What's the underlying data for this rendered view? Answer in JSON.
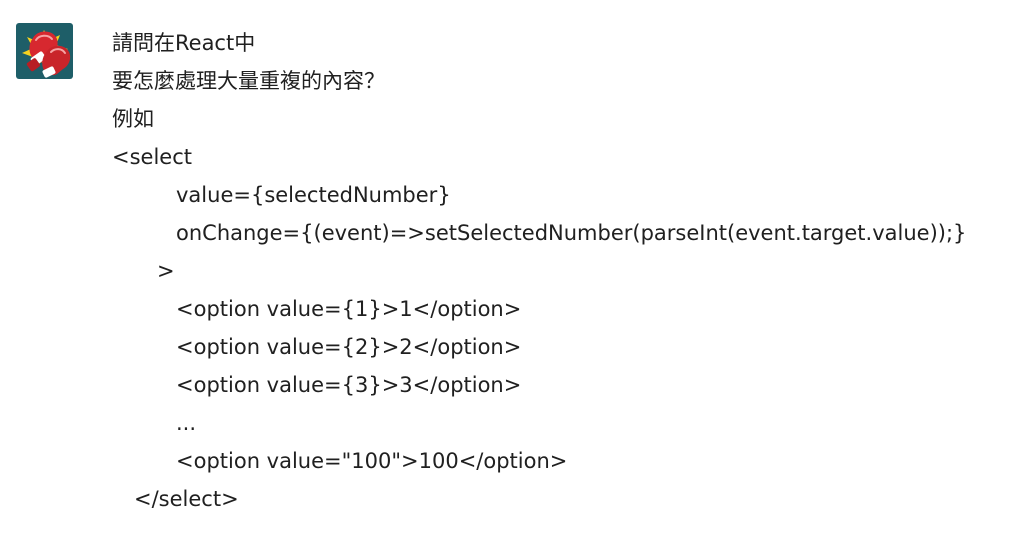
{
  "message": {
    "lines": [
      "請問在React中",
      "要怎麼處理大量重複的內容？",
      "例如",
      "<select",
      "value={selectedNumber}",
      "onChange={(event)=>setSelectedNumber(parseInt(event.target.value));}",
      ">",
      "<option value={1}>1</option>",
      "<option value={2}>2</option>",
      "<option value={3}>3</option>",
      "...",
      "<option value=\"100\">100</option>",
      "</select>"
    ]
  },
  "avatar": {
    "icon": "boxing-glove-icon",
    "background": "#1e5e68",
    "accent": "#d7282f",
    "burst": "#f4d21f"
  }
}
